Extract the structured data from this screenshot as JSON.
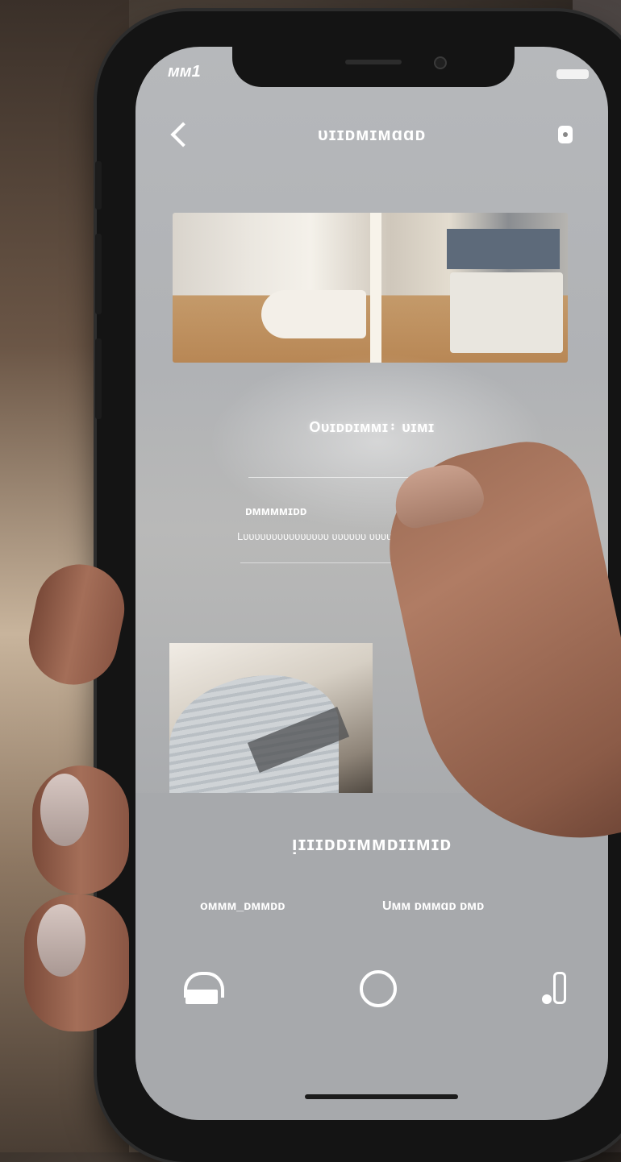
{
  "status_bar": {
    "carrier": "ᴍᴍ1"
  },
  "header": {
    "title": "ᴜɪɪᴅᴍɪᴍɑɑᴅ"
  },
  "content": {
    "section_heading": "Oᴜɪᴅᴅɪᴍᴍɪ᛬ ᴜɪᴍɪ",
    "label_small": "ᴅᴍᴍᴍᴍɪᴅᴅ",
    "label_sub": "Lᴜᴜᴜᴜᴜᴜᴜᴜᴜᴜᴜᴜᴜᴜᴜ ᴜᴜᴜᴜᴜᴜ ᴜᴜᴜᴜ"
  },
  "bottom_sheet": {
    "title": "ᴉɪɪɪᴅᴅɪᴍᴍᴅɪɪᴍɪᴅ",
    "left_label": "ᴏᴍᴍᴍ_ᴅᴍᴍᴅᴅ",
    "right_label": "Uᴍᴍ ᴅᴍᴍɑᴅ ᴅᴍᴅ"
  },
  "colors": {
    "screen_bg": "#b4b6b9",
    "accent": "#ffffff",
    "phone_frame": "#141414"
  }
}
